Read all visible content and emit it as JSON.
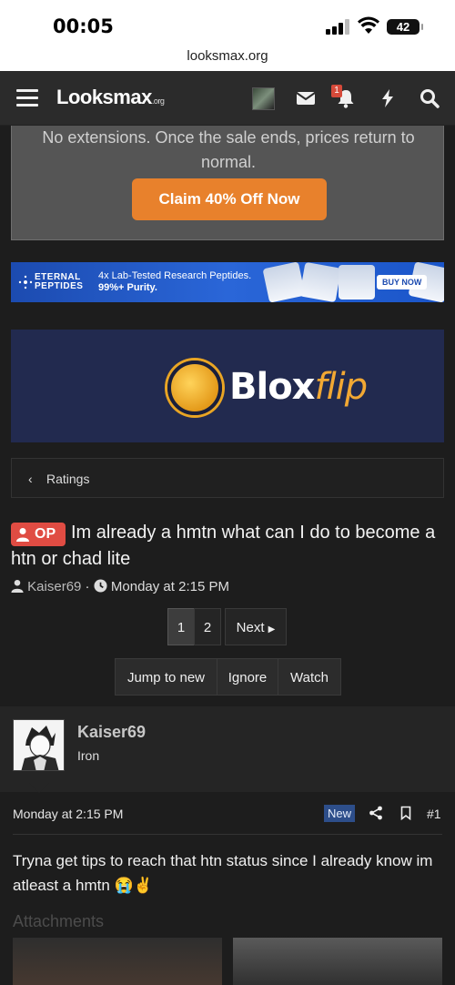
{
  "status_bar": {
    "time": "00:05",
    "battery": "42"
  },
  "url": "looksmax.org",
  "nav": {
    "logo": "Looksmax",
    "logo_suffix": ".org",
    "notification_count": "1"
  },
  "sale": {
    "text": "No extensions. Once the sale ends, prices return to normal.",
    "claim_label": "Claim 40% Off Now"
  },
  "ads": {
    "eternal": {
      "brand_line1": "ETERNAL",
      "brand_line2": "PEPTIDES",
      "tag1": "4x Lab-Tested Research Peptides.",
      "tag2": "99%+ Purity.",
      "cta": "BUY NOW"
    },
    "blox": {
      "word_main": "Blox",
      "word_accent": "flip"
    }
  },
  "breadcrumb": {
    "label": "Ratings"
  },
  "thread": {
    "badge": "OP",
    "title": "Im already a hmtn what can I do to become a htn or chad lite",
    "author": "Kaiser69",
    "separator": "·",
    "date": "Monday at 2:15 PM"
  },
  "pagination": {
    "pages": [
      "1",
      "2"
    ],
    "next_label": "Next"
  },
  "actions": {
    "jump": "Jump to new",
    "ignore": "Ignore",
    "watch": "Watch"
  },
  "post": {
    "username": "Kaiser69",
    "rank": "Iron",
    "date": "Monday at 2:15 PM",
    "new_label": "New",
    "number": "#1",
    "body": "Tryna get tips to reach that htn status since I already know im atleast a hmtn 😭✌️",
    "attachments_label": "Attachments"
  },
  "colors": {
    "accent": "#e8812c",
    "op_badge": "#e04c43",
    "new_badge": "#2d4e8a",
    "background": "#1d1d1d"
  }
}
